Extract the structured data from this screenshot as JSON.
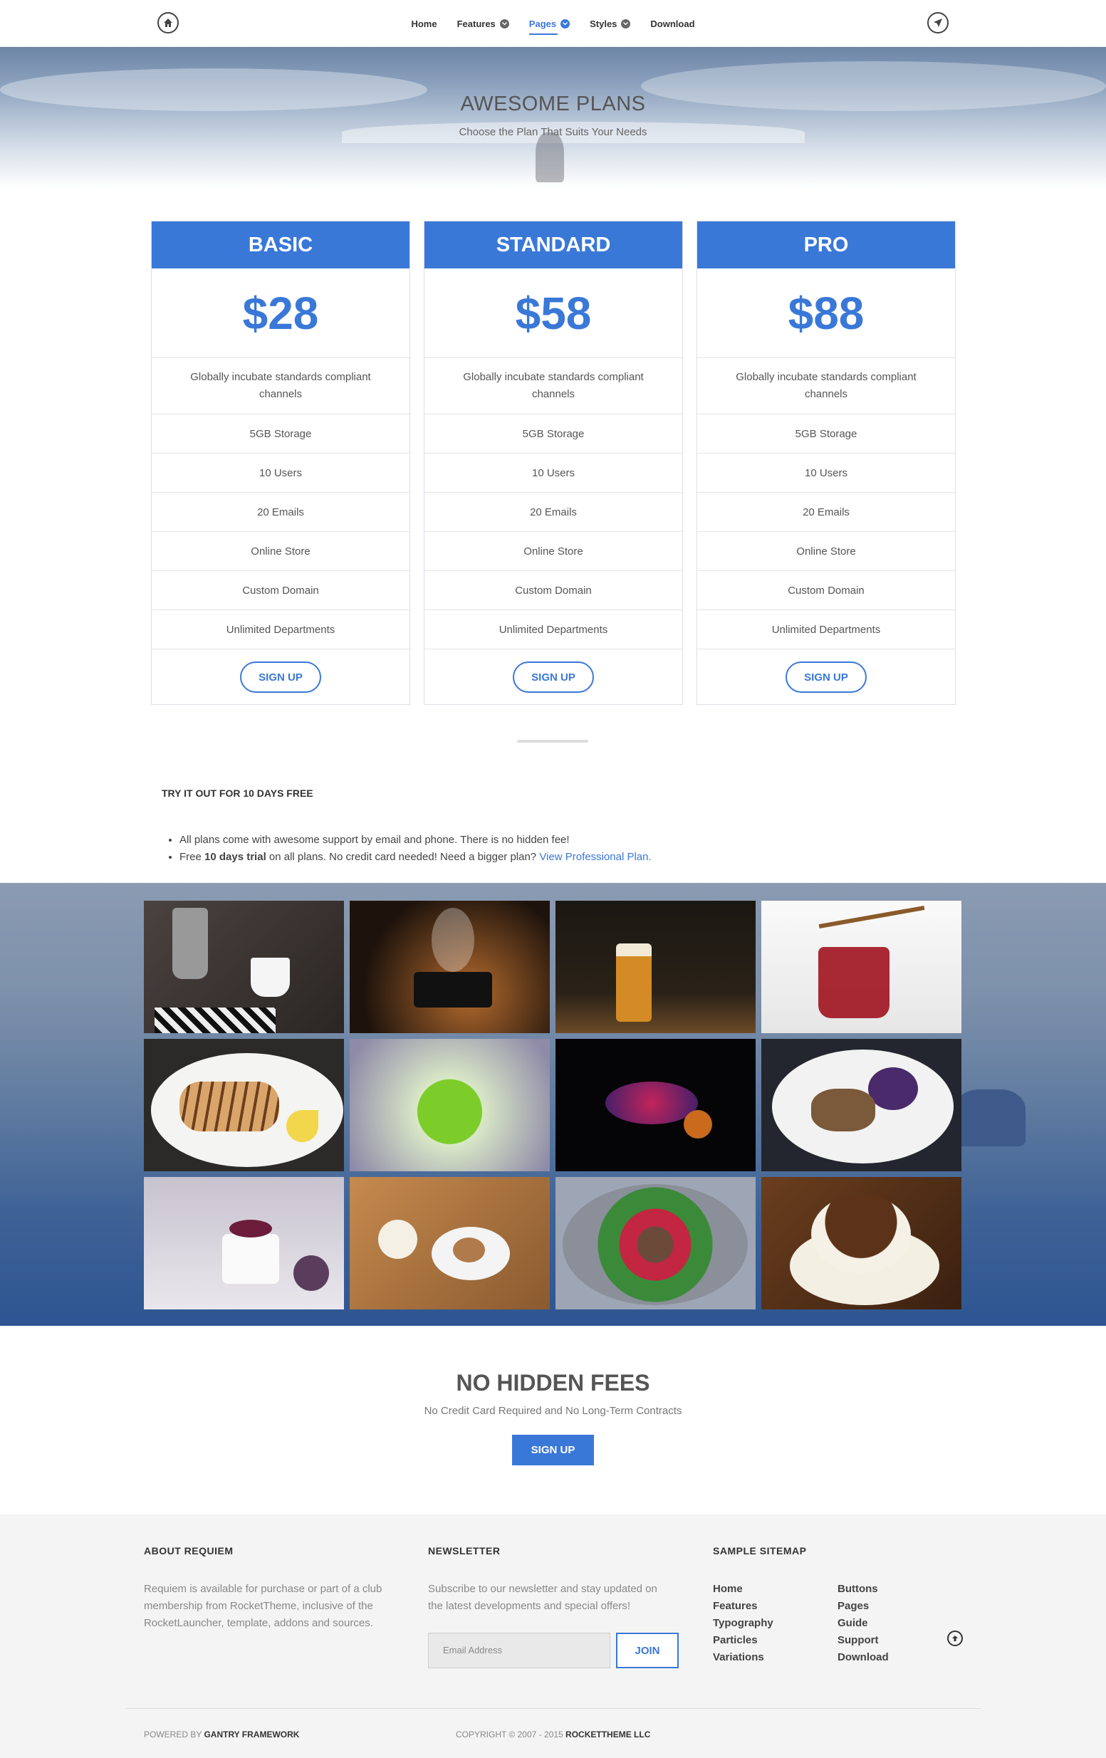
{
  "nav": {
    "items": [
      {
        "label": "Home",
        "dropdown": false
      },
      {
        "label": "Features",
        "dropdown": true
      },
      {
        "label": "Pages",
        "dropdown": true,
        "active": true
      },
      {
        "label": "Styles",
        "dropdown": true
      },
      {
        "label": "Download",
        "dropdown": false
      }
    ]
  },
  "hero": {
    "title": "AWESOME PLANS",
    "subtitle": "Choose the Plan That Suits Your Needs"
  },
  "plans": [
    {
      "name": "BASIC",
      "price": "$28",
      "features": [
        "Globally incubate standards compliant channels",
        "5GB Storage",
        "10 Users",
        "20 Emails",
        "Online Store",
        "Custom Domain",
        "Unlimited Departments"
      ],
      "button": "SIGN UP"
    },
    {
      "name": "STANDARD",
      "price": "$58",
      "features": [
        "Globally incubate standards compliant channels",
        "5GB Storage",
        "10 Users",
        "20 Emails",
        "Online Store",
        "Custom Domain",
        "Unlimited Departments"
      ],
      "button": "SIGN UP"
    },
    {
      "name": "PRO",
      "price": "$88",
      "features": [
        "Globally incubate standards compliant channels",
        "5GB Storage",
        "10 Users",
        "20 Emails",
        "Online Store",
        "Custom Domain",
        "Unlimited Departments"
      ],
      "button": "SIGN UP"
    }
  ],
  "trial": {
    "title": "TRY IT OUT FOR 10 DAYS FREE",
    "bullet1": "All plans come with awesome support by email and phone. There is no hidden fee!",
    "bullet2_pre": "Free ",
    "bullet2_bold": "10 days trial",
    "bullet2_mid": " on all plans. No credit card needed! Need a bigger plan? ",
    "bullet2_link": "View Professional Plan."
  },
  "gallery": {
    "tiles": [
      "coffee-pot",
      "steaming-pot",
      "beer",
      "honey-tea",
      "grilled-fish",
      "flowers",
      "fish",
      "plated-dish",
      "dessert",
      "tea-and-bread",
      "salad-bowl",
      "coffee-cup"
    ]
  },
  "cta": {
    "title": "NO HIDDEN FEES",
    "subtitle": "No Credit Card Required and No Long-Term Contracts",
    "button": "SIGN UP"
  },
  "footer": {
    "about_title": "ABOUT REQUIEM",
    "about_text": "Requiem is available for purchase or part of a club membership from RocketTheme, inclusive of the RocketLauncher, template, addons and sources.",
    "newsletter_title": "NEWSLETTER",
    "newsletter_text": "Subscribe to our newsletter and stay updated on the latest developments and special offers!",
    "email_placeholder": "Email Address",
    "join_label": "JOIN",
    "sitemap_title": "SAMPLE SITEMAP",
    "sitemap_col1": [
      "Home",
      "Features",
      "Typography",
      "Particles",
      "Variations"
    ],
    "sitemap_col2": [
      "Buttons",
      "Pages",
      "Guide",
      "Support",
      "Download"
    ],
    "powered_pre": "POWERED BY ",
    "powered_bold": "GANTRY FRAMEWORK",
    "copyright_pre": "COPYRIGHT © 2007 - 2015 ",
    "copyright_bold": "ROCKETTHEME LLC"
  },
  "colors": {
    "accent": "#3a78d8"
  }
}
